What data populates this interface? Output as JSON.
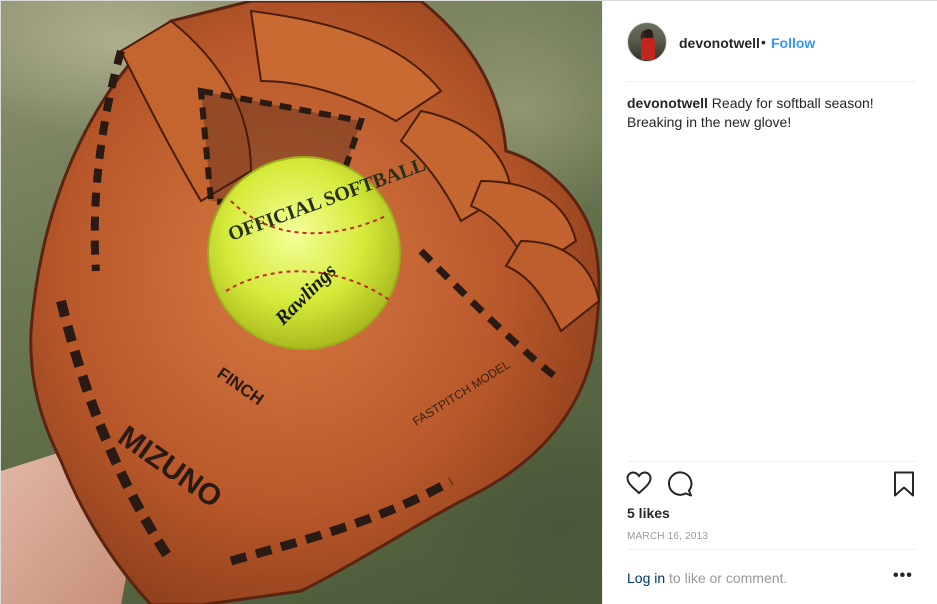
{
  "post": {
    "image_alt": "Softball in a Mizuno glove",
    "glove_brand": "MIZUNO",
    "glove_model": "FINCH",
    "glove_text": "FASTPITCH MODEL",
    "ball_text": "OFFICIAL SOFTBALL",
    "ball_brand": "Rawlings"
  },
  "header": {
    "username": "devonotwell",
    "separator": "•",
    "follow_label": "Follow"
  },
  "caption": {
    "username": "devonotwell",
    "text": "Ready for softball season! Breaking in the new glove!"
  },
  "actions": {
    "like_icon": "heart-icon",
    "comment_icon": "comment-icon",
    "save_icon": "bookmark-icon"
  },
  "stats": {
    "likes": "5 likes",
    "date": "MARCH 16, 2013"
  },
  "footer": {
    "login_label": "Log in",
    "login_suffix": " to like or comment.",
    "more_label": "•••"
  },
  "colors": {
    "accent": "#3897f0",
    "link_dark": "#003569",
    "muted": "#999999",
    "border": "#efefef"
  }
}
